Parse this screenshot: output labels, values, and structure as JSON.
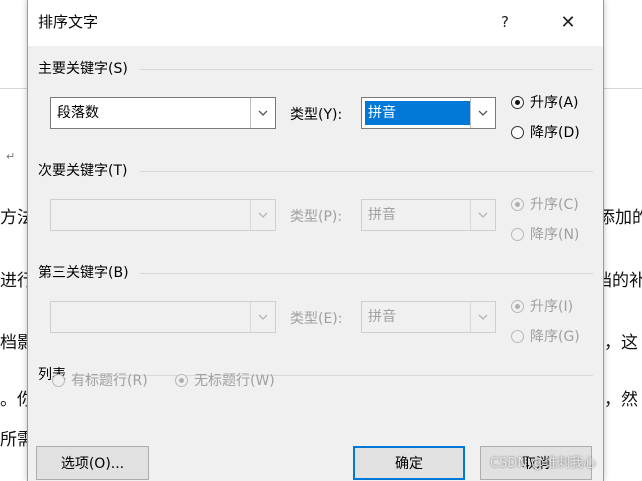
{
  "dialog": {
    "title": "排序文字",
    "help_glyph": "?",
    "close_glyph": "✕"
  },
  "primary": {
    "label": "主要关键字(S)",
    "field_value": "段落数",
    "type_label": "类型(Y):",
    "type_value": "拼音",
    "asc_label": "升序(A)",
    "desc_label": "降序(D)",
    "asc_selected": true
  },
  "secondary": {
    "label": "次要关键字(T)",
    "field_value": "",
    "type_label": "类型(P):",
    "type_value": "拼音",
    "asc_label": "升序(C)",
    "desc_label": "降序(N)"
  },
  "tertiary": {
    "label": "第三关键字(B)",
    "field_value": "",
    "type_label": "类型(E):",
    "type_value": "拼音",
    "asc_label": "升序(I)",
    "desc_label": "降序(G)"
  },
  "list": {
    "label": "列表",
    "header_row_label": "有标题行(R)",
    "no_header_row_label": "无标题行(W)"
  },
  "buttons": {
    "options": "选项(O)...",
    "ok": "确定",
    "cancel": "取消"
  },
  "background_text": {
    "left_1": "方法",
    "left_2": "进行",
    "left_3": "档影",
    "left_4": "。你",
    "left_5": "所需",
    "right_1": "添加的",
    "right_2": "档的补",
    "right_3": "，这",
    "right_4": "，然",
    "para_mark": "↵"
  },
  "watermark": "CSDN @谁刺我心",
  "colors": {
    "accent": "#0078d7",
    "dialog_bg": "#f0f0f0",
    "disabled_text": "#a0a0a0"
  }
}
